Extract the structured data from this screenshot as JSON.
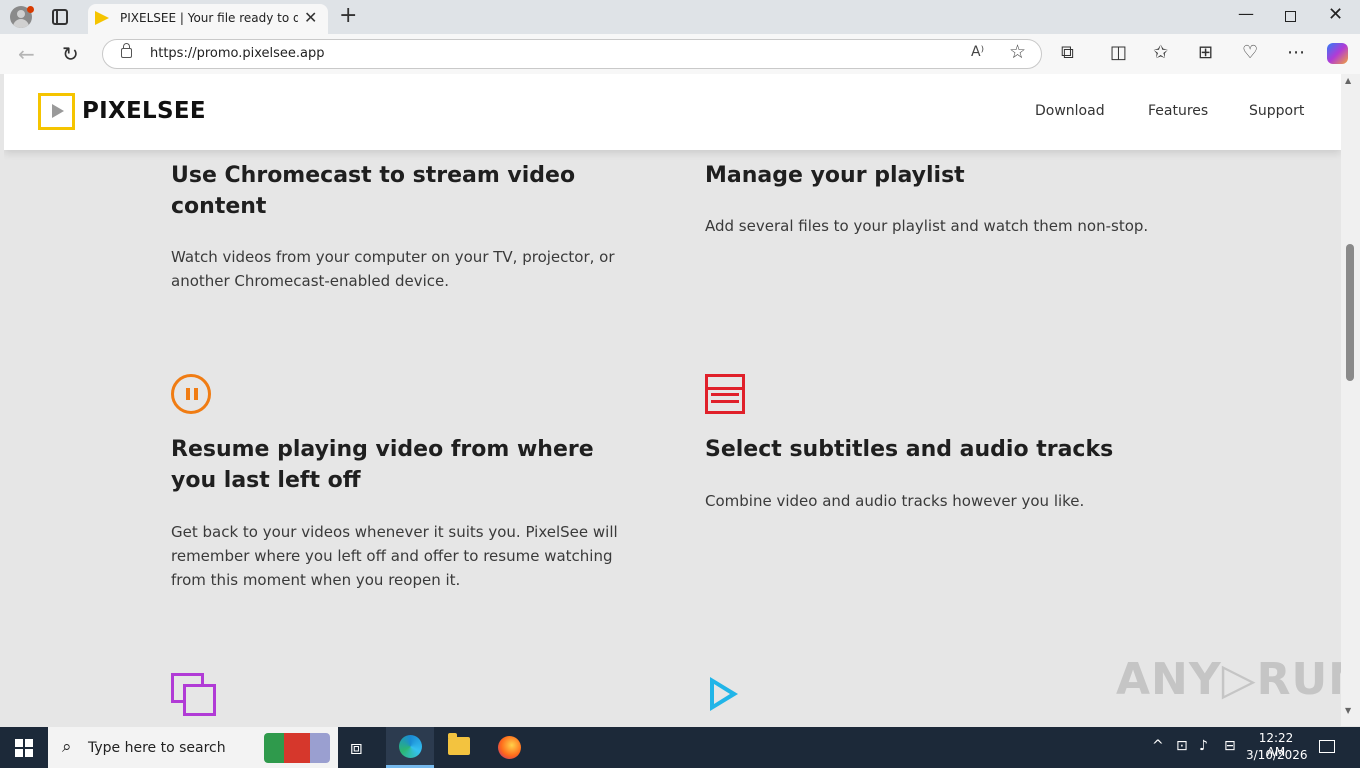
{
  "browser": {
    "tab_title": "PIXELSEE | Your file ready to down",
    "tab_close": "✕",
    "new_tab": "+",
    "url": "https://promo.pixelsee.app",
    "read_aloud": "A⁾",
    "window": {
      "minimize": "—",
      "close": "✕"
    }
  },
  "site": {
    "logo_text": "PIXELSEE",
    "nav": [
      "Download",
      "Features",
      "Support"
    ]
  },
  "features": [
    {
      "title": "Use Chromecast to stream video content",
      "desc": "Watch videos from your computer on your TV, projector, or another Chromecast-enabled device."
    },
    {
      "title": "Manage your playlist",
      "desc": "Add several files to your playlist and watch them non-stop."
    },
    {
      "title": "Resume playing video from where you last left off",
      "desc": "Get back to your videos whenever it suits you. PixelSee will remember where you left off and offer to resume watching from this moment when you reopen it.",
      "icon": "pause-circle-icon"
    },
    {
      "title": "Select subtitles and audio tracks",
      "desc": "Combine video and audio tracks however you like.",
      "icon": "subtitles-icon"
    }
  ],
  "watermark": "ANY▷RUN",
  "taskbar": {
    "search_placeholder": "Type here to search",
    "time": "12:22 AM",
    "date": "3/10/2026"
  },
  "colors": {
    "brand_yellow": "#f5c400",
    "pause_orange": "#f07c13",
    "subtitles_red": "#e0202a",
    "pip_purple": "#b13bd6",
    "play_blue": "#21b5e8"
  }
}
